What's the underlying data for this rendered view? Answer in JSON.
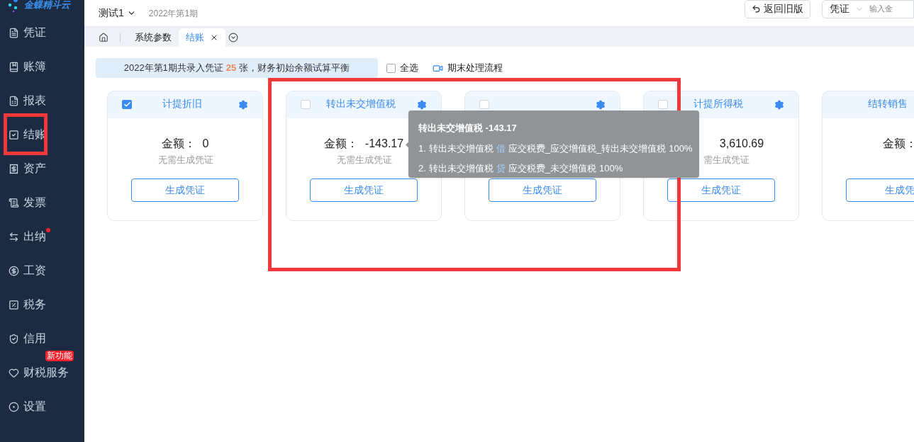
{
  "logo": {
    "text": "金蝶精斗云"
  },
  "sidebar": {
    "items": [
      {
        "label": "凭证",
        "annotated": false
      },
      {
        "label": "账簿",
        "annotated": false
      },
      {
        "label": "报表",
        "annotated": false
      },
      {
        "label": "结账",
        "annotated": true
      },
      {
        "label": "资产",
        "annotated": false
      },
      {
        "label": "发票",
        "annotated": false
      },
      {
        "label": "出纳",
        "annotated": false,
        "dot": true
      },
      {
        "label": "工资",
        "annotated": false
      },
      {
        "label": "税务",
        "annotated": false
      },
      {
        "label": "信用",
        "annotated": false
      },
      {
        "label": "财税服务",
        "annotated": false,
        "badge": "新功能"
      },
      {
        "label": "设置",
        "annotated": false
      }
    ]
  },
  "header": {
    "account": "测试1",
    "period": "2022年第1期",
    "back_button": "返回旧版",
    "type_select": "凭证",
    "amount_placeholder": "输入金"
  },
  "tabs": [
    {
      "label": "系统参数",
      "selected": false,
      "closable": false
    },
    {
      "label": "结账",
      "selected": true,
      "closable": true
    }
  ],
  "banner": {
    "prefix": "2022年第1期共录入凭证",
    "count": "25",
    "suffix": "张，财务初始余额试算平衡"
  },
  "select_all": {
    "label": "全选",
    "checked": false
  },
  "flow_link": "期末处理流程",
  "cards": [
    {
      "title": "计提折旧",
      "checked": true,
      "amount_label": "金额：",
      "amount": "0",
      "hint": "无需生成凭证",
      "button": "生成凭证"
    },
    {
      "title": "转出未交增值税",
      "checked": false,
      "amount_label": "金额：",
      "amount": "-143.17",
      "hint": "无需生成凭证",
      "button": "生成凭证",
      "info": true
    },
    {
      "checked": false,
      "button": "生成凭证"
    },
    {
      "title": "计提所得税",
      "checked": false,
      "amount": "3,610.69",
      "hint": "需生成凭证",
      "button": "生成凭证"
    },
    {
      "title": "结转销售",
      "amount_label": "金额：",
      "button": "生成凭"
    }
  ],
  "tooltip": {
    "title": "转出未交增值税 -143.17",
    "lines": [
      {
        "number": "1.",
        "name": "转出未交增值税",
        "direction": "借",
        "account": "应交税费_应交增值税_转出未交增值税",
        "percent": "100%"
      },
      {
        "number": "2.",
        "name": "转出未交增值税",
        "direction": "贷",
        "account": "应交税费_未交增值税",
        "percent": "100%"
      }
    ]
  },
  "annotation": {
    "kind": "red-box"
  }
}
